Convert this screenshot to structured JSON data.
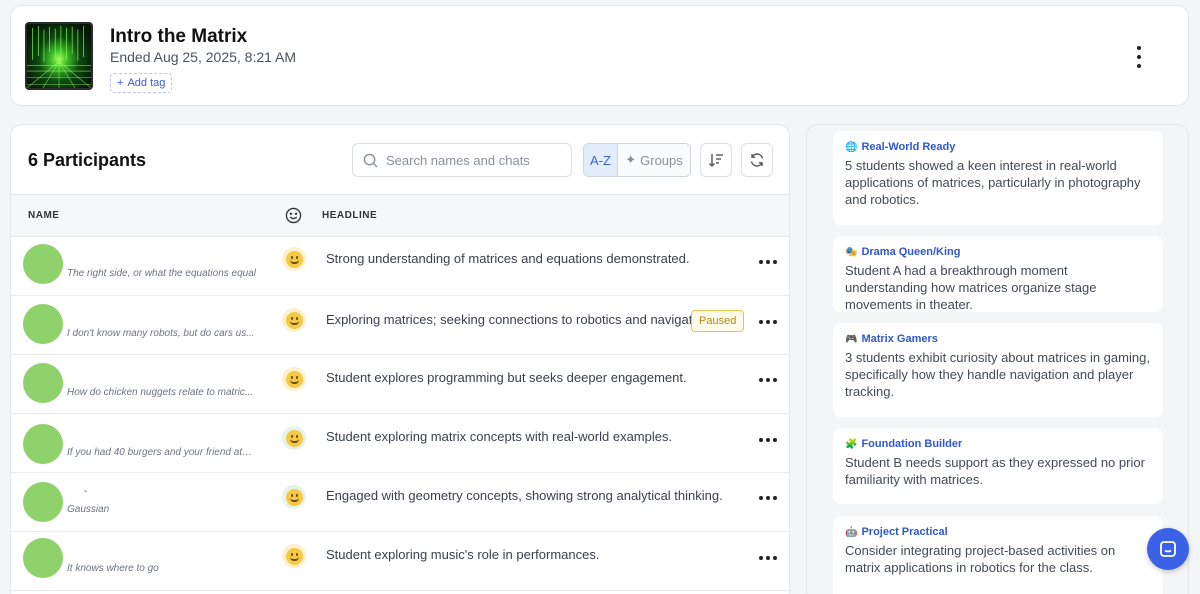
{
  "session": {
    "title": "Intro the Matrix",
    "ended": "Ended Aug 25, 2025, 8:21 AM",
    "add_tag": "Add tag"
  },
  "participants": {
    "title": "6 Participants",
    "search_placeholder": "Search names and chats",
    "sort_az": "A-Z",
    "groups": "Groups",
    "col_name": "NAME",
    "col_headline": "HEADLINE",
    "rows": [
      {
        "quote": "The right side, or what the equations equal",
        "headline": "Strong understanding of matrices and equations demonstrated.",
        "badge": ""
      },
      {
        "quote": "I don't know many robots, but do cars us...",
        "headline": "Exploring matrices; seeking connections to robotics and navigation.",
        "badge": "Paused"
      },
      {
        "quote": "How do chicken nuggets relate to matric...",
        "headline": "Student explores programming but seeks deeper engagement.",
        "badge": ""
      },
      {
        "quote": "If you had 40 burgers and your friend ate ...",
        "headline": "Student exploring matrix concepts with real-world examples.",
        "badge": ""
      },
      {
        "quote": "Gaussian",
        "extra": "-",
        "headline": "Engaged with geometry concepts, showing strong analytical thinking.",
        "badge": ""
      },
      {
        "quote": "It knows where to go",
        "headline": "Student exploring music's role in performances.",
        "badge": ""
      }
    ]
  },
  "insights": [
    {
      "icon": "🌐",
      "title": "Real-World Ready",
      "body": "5 students showed a keen interest in real-world applications of matrices, particularly in photography and robotics."
    },
    {
      "icon": "🎭",
      "title": "Drama Queen/King",
      "body": "Student A had a breakthrough moment understanding how matrices organize stage movements in theater."
    },
    {
      "icon": "🎮",
      "title": "Matrix Gamers",
      "body": "3 students exhibit curiosity about matrices in gaming, specifically how they handle navigation and player tracking."
    },
    {
      "icon": "🧩",
      "title": "Foundation Builder",
      "body": "Student B needs support as they expressed no prior familiarity with matrices."
    },
    {
      "icon": "🤖",
      "title": "Project Practical",
      "body": "Consider integrating project-based activities on matrix applications in robotics for the class."
    }
  ],
  "colors": {
    "accent": "#3b62e6",
    "avatar": "#8fd16a",
    "paused": "#e6c34a"
  }
}
